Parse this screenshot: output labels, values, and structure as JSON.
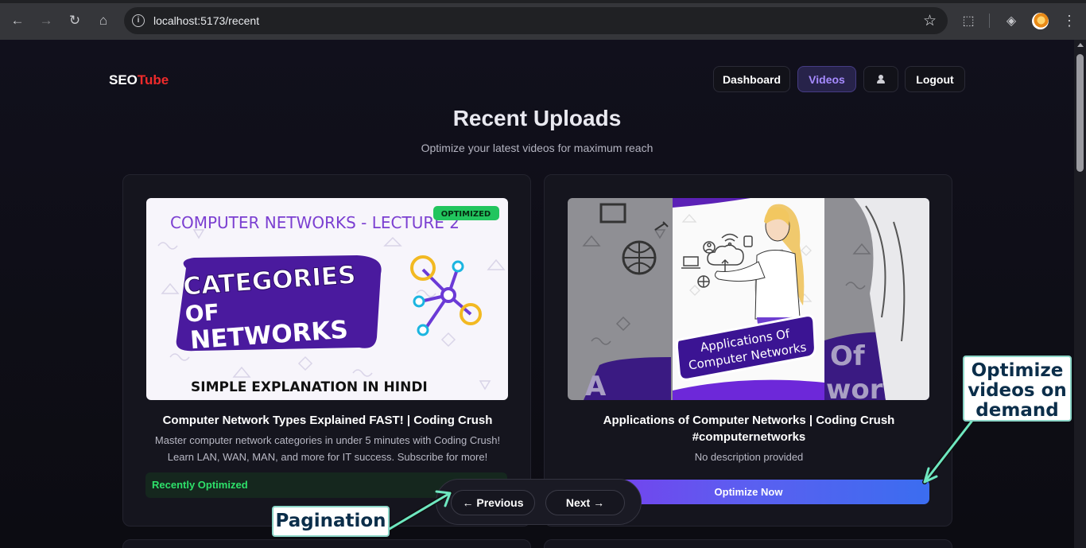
{
  "browser": {
    "url": "localhost:5173/recent",
    "back_glyph": "←",
    "forward_glyph": "→",
    "reload_glyph": "↻",
    "home_glyph": "⌂",
    "info_glyph": "i",
    "star_glyph": "☆",
    "ext_glyph": "⬚",
    "shield_glyph": "◈",
    "menu_glyph": "⋮"
  },
  "header": {
    "logo_part1": "SEO",
    "logo_part2": "Tube",
    "nav": [
      "Dashboard",
      "Videos",
      "Logout"
    ],
    "active_nav": "Videos"
  },
  "main": {
    "title": "Recent Uploads",
    "subtitle": "Optimize your latest videos for maximum reach"
  },
  "videos": [
    {
      "title": "Computer Network Types Explained FAST! | Coding Crush",
      "description": "Master computer network categories in under 5 minutes with Coding Crush! Learn LAN, WAN, MAN, and more for IT success. Subscribe for more!",
      "status_badge": "Recently Optimized",
      "thumb": {
        "tag": "OPTIMIZED",
        "heading": "COMPUTER  NETWORKS - LECTURE 2",
        "line1": "CATEGORIES",
        "line2": "OF",
        "line3": "NETWORKS",
        "footer": "SIMPLE  EXPLANATION  IN  HINDI"
      }
    },
    {
      "title": "Applications of Computer Networks | Coding Crush #computernetworks",
      "description": "No description provided",
      "action": "Optimize Now",
      "thumb": {
        "banner_line1": "Applications Of",
        "banner_line2": "Computer Networks",
        "bg_text_left": "A",
        "bg_text_right_1": "Of",
        "bg_text_right_2": "works"
      }
    }
  ],
  "pagination": {
    "previous": "← Previous",
    "next": "Next →"
  },
  "annotations": {
    "pagination": "Pagination",
    "optimize": "Optimize videos on demand"
  },
  "colors": {
    "accent": "#a68bff",
    "brand_red": "#ef2b2b",
    "success_green": "#2ee06a",
    "thumb_purple": "#4a1a9e"
  }
}
